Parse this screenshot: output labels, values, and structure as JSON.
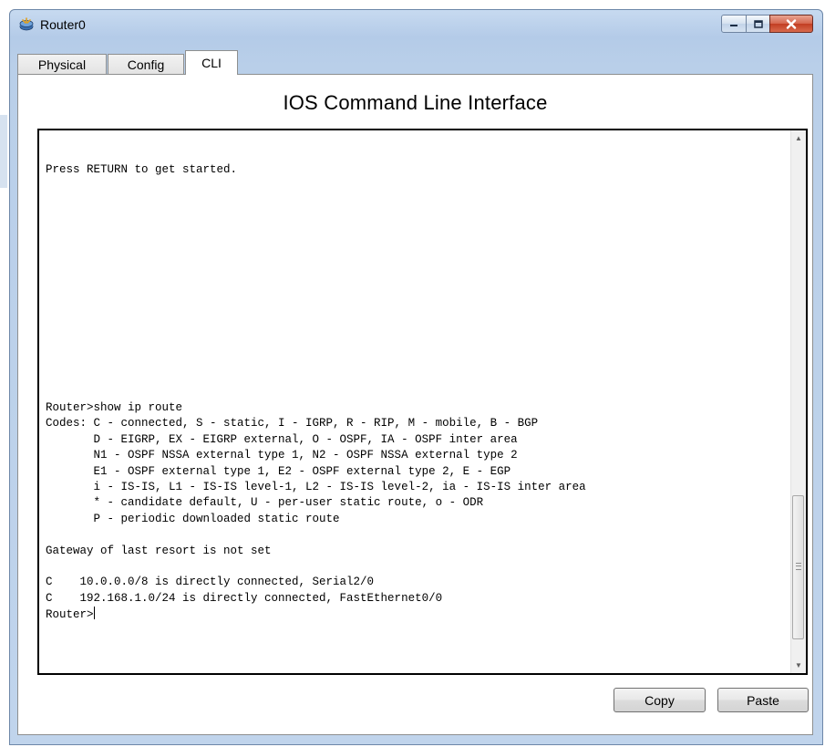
{
  "window": {
    "title": "Router0",
    "app_icon": "router-icon"
  },
  "tabs": [
    {
      "label": "Physical",
      "active": false
    },
    {
      "label": "Config",
      "active": false
    },
    {
      "label": "CLI",
      "active": true
    }
  ],
  "cli": {
    "heading": "IOS Command Line Interface",
    "lines": [
      "",
      "",
      "Press RETURN to get started.",
      "",
      "",
      "",
      "",
      "",
      "",
      "",
      "",
      "",
      "",
      "",
      "",
      "",
      "",
      "Router>show ip route",
      "Codes: C - connected, S - static, I - IGRP, R - RIP, M - mobile, B - BGP",
      "       D - EIGRP, EX - EIGRP external, O - OSPF, IA - OSPF inter area",
      "       N1 - OSPF NSSA external type 1, N2 - OSPF NSSA external type 2",
      "       E1 - OSPF external type 1, E2 - OSPF external type 2, E - EGP",
      "       i - IS-IS, L1 - IS-IS level-1, L2 - IS-IS level-2, ia - IS-IS inter area",
      "       * - candidate default, U - per-user static route, o - ODR",
      "       P - periodic downloaded static route",
      "",
      "Gateway of last resort is not set",
      "",
      "C    10.0.0.0/8 is directly connected, Serial2/0",
      "C    192.168.1.0/24 is directly connected, FastEthernet0/0"
    ],
    "prompt": "Router>"
  },
  "buttons": {
    "copy": "Copy",
    "paste": "Paste"
  },
  "colors": {
    "close_button": "#c9432a",
    "frame": "#b9cfe9"
  }
}
